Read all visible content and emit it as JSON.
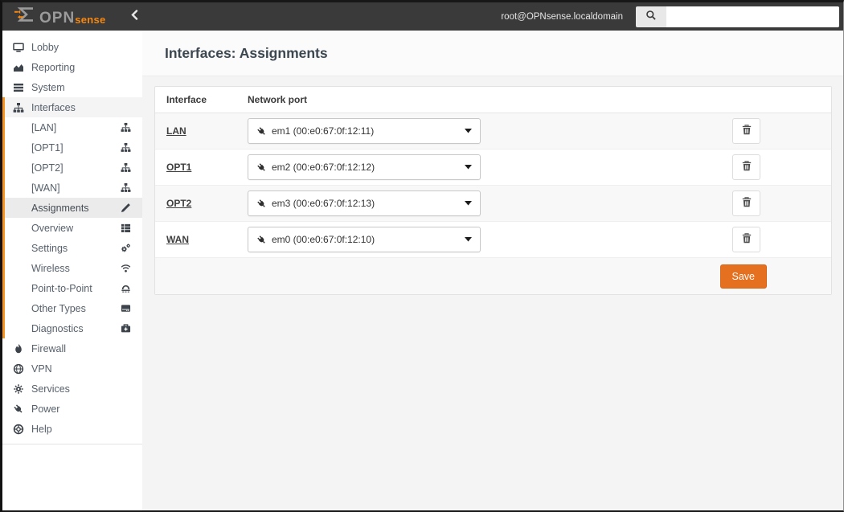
{
  "header": {
    "logo_prefix": "OPN",
    "logo_suffix": "sense",
    "user": "root@OPNsense.localdomain",
    "search_placeholder": ""
  },
  "sidebar": {
    "items": [
      {
        "label": "Lobby",
        "icon": "desktop"
      },
      {
        "label": "Reporting",
        "icon": "area-chart"
      },
      {
        "label": "System",
        "icon": "tasks"
      },
      {
        "label": "Interfaces",
        "icon": "sitemap",
        "active": true,
        "children": [
          {
            "label": "[LAN]",
            "icon": "sitemap"
          },
          {
            "label": "[OPT1]",
            "icon": "sitemap"
          },
          {
            "label": "[OPT2]",
            "icon": "sitemap"
          },
          {
            "label": "[WAN]",
            "icon": "sitemap"
          },
          {
            "label": "Assignments",
            "icon": "pencil",
            "selected": true
          },
          {
            "label": "Overview",
            "icon": "list-alt"
          },
          {
            "label": "Settings",
            "icon": "cogs"
          },
          {
            "label": "Wireless",
            "icon": "wifi"
          },
          {
            "label": "Point-to-Point",
            "icon": "modem"
          },
          {
            "label": "Other Types",
            "icon": "hdd"
          },
          {
            "label": "Diagnostics",
            "icon": "medkit"
          }
        ]
      },
      {
        "label": "Firewall",
        "icon": "fire"
      },
      {
        "label": "VPN",
        "icon": "globe"
      },
      {
        "label": "Services",
        "icon": "gear"
      },
      {
        "label": "Power",
        "icon": "plug"
      },
      {
        "label": "Help",
        "icon": "life-ring"
      }
    ]
  },
  "main": {
    "title": "Interfaces: Assignments",
    "table": {
      "col_interface": "Interface",
      "col_port": "Network port",
      "rows": [
        {
          "interface": "LAN",
          "port": "em1 (00:e0:67:0f:12:11)"
        },
        {
          "interface": "OPT1",
          "port": "em2 (00:e0:67:0f:12:12)"
        },
        {
          "interface": "OPT2",
          "port": "em3 (00:e0:67:0f:12:13)"
        },
        {
          "interface": "WAN",
          "port": "em0 (00:e0:67:0f:12:10)"
        }
      ],
      "save_label": "Save"
    }
  },
  "colors": {
    "brand_orange": "#e5701f",
    "logo_orange": "#f7870f",
    "active_section_border": "#f7941e",
    "topbar_bg": "#3a3a3a",
    "panel_stripe": "#f8f8f8"
  }
}
